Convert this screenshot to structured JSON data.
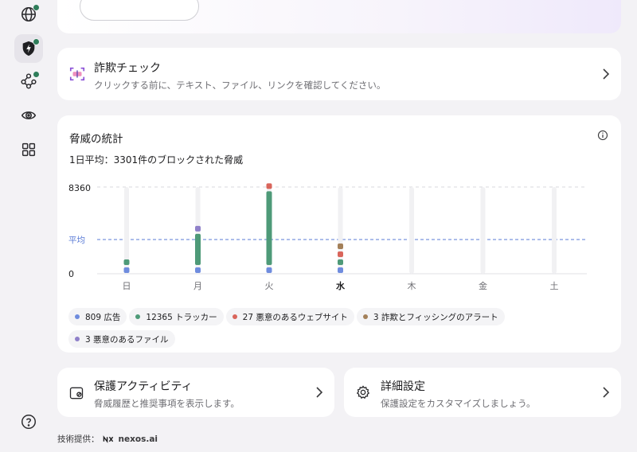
{
  "colors": {
    "ads": "#6f8cde",
    "trackers": "#4e9a78",
    "malicious_sites": "#d9655b",
    "scam_alerts": "#a38059",
    "malicious_files": "#8f80c9",
    "avg_line": "#5a7bd6",
    "accent_green": "#2f7d5a"
  },
  "sidebar": {
    "items": [
      {
        "icon": "globe-icon",
        "badge": true
      },
      {
        "icon": "shield-bolt-icon",
        "badge": true,
        "active": true
      },
      {
        "icon": "network-nodes-icon",
        "badge": true
      },
      {
        "icon": "eye-target-icon",
        "badge": false
      },
      {
        "icon": "grid-apps-icon",
        "badge": false
      }
    ],
    "help_icon": "question-circle-icon"
  },
  "scam_check": {
    "title": "詐欺チェック",
    "subtitle": "クリックする前に、テキスト、ファイル、リンクを確認してください。",
    "icon": "scan-frame-icon"
  },
  "stats": {
    "title": "脅威の統計",
    "daily_avg_prefix": "1日平均：",
    "daily_avg_value": "3301件のブロックされた脅威",
    "info_icon": "info-circle-icon"
  },
  "chart_data": {
    "type": "bar",
    "y_top_label": "8360",
    "y_zero_label": "0",
    "avg_label": "平均",
    "average": 3301,
    "ylim": [
      0,
      8360
    ],
    "categories": [
      "日",
      "月",
      "火",
      "水",
      "木",
      "金",
      "土"
    ],
    "current_day": "水",
    "series": [
      {
        "key": "ads",
        "values": [
          1,
          1,
          1,
          1,
          0,
          0,
          0
        ]
      },
      {
        "key": "trackers",
        "values": [
          1,
          3000,
          7100,
          1,
          0,
          0,
          0
        ]
      },
      {
        "key": "malicious_sites",
        "values": [
          0,
          0,
          1,
          1,
          0,
          0,
          0
        ]
      },
      {
        "key": "scam_alerts",
        "values": [
          0,
          0,
          0,
          1,
          0,
          0,
          0
        ]
      },
      {
        "key": "malicious_files",
        "values": [
          0,
          1,
          0,
          0,
          0,
          0,
          0
        ]
      }
    ],
    "legend": [
      {
        "key": "ads",
        "label": "809 広告"
      },
      {
        "key": "trackers",
        "label": "12365 トラッカー"
      },
      {
        "key": "malicious_sites",
        "label": "27 悪意のあるウェブサイト"
      },
      {
        "key": "scam_alerts",
        "label": "3 詐欺とフィッシングのアラート"
      },
      {
        "key": "malicious_files",
        "label": "3 悪意のあるファイル"
      }
    ]
  },
  "activity": {
    "title": "保護アクティビティ",
    "subtitle": "脅威履歴と推奨事項を表示します。",
    "icon": "activity-window-icon"
  },
  "settings": {
    "title": "詳細設定",
    "subtitle": "保護設定をカスタマイズしましょう。",
    "icon": "gear-icon"
  },
  "footer": {
    "prefix": "技術提供：",
    "brand": "nexos.ai",
    "logo": "nexos-logo-icon"
  }
}
